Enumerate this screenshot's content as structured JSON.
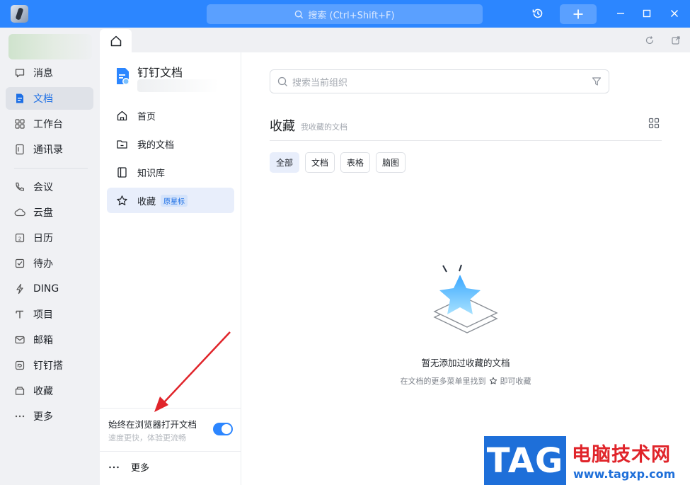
{
  "titlebar": {
    "search_placeholder": "搜索 (Ctrl+Shift+F)",
    "icons": [
      "app-logo",
      "history-icon",
      "plus-icon",
      "minimize-icon",
      "maximize-icon",
      "close-icon"
    ]
  },
  "rail": {
    "items": [
      {
        "label": "消息",
        "icon": "message-icon"
      },
      {
        "label": "文档",
        "icon": "document-icon",
        "active": true
      },
      {
        "label": "工作台",
        "icon": "workbench-icon"
      },
      {
        "label": "通讯录",
        "icon": "contacts-icon"
      },
      {
        "label": "会议",
        "icon": "meeting-icon"
      },
      {
        "label": "云盘",
        "icon": "cloud-icon"
      },
      {
        "label": "日历",
        "icon": "calendar-icon"
      },
      {
        "label": "待办",
        "icon": "todo-icon"
      },
      {
        "label": "DING",
        "icon": "ding-icon"
      },
      {
        "label": "项目",
        "icon": "project-icon"
      },
      {
        "label": "邮箱",
        "icon": "mail-icon"
      },
      {
        "label": "钉钉搭",
        "icon": "builder-icon"
      },
      {
        "label": "收藏",
        "icon": "favorites-icon"
      },
      {
        "label": "更多",
        "icon": "more-icon"
      }
    ]
  },
  "docnav": {
    "title": "钉钉文档",
    "items": [
      {
        "label": "首页",
        "icon": "home-icon"
      },
      {
        "label": "我的文档",
        "icon": "folder-icon"
      },
      {
        "label": "知识库",
        "icon": "book-icon"
      },
      {
        "label": "收藏",
        "icon": "star-icon",
        "badge": "原星标",
        "active": true
      }
    ],
    "browser_toggle_label": "始终在浏览器打开文档",
    "browser_toggle_sub": "速度更快，体验更流畅",
    "browser_toggle_on": true,
    "more_label": "更多"
  },
  "main": {
    "search_placeholder": "搜索当前组织",
    "section_title": "收藏",
    "section_sub": "我收藏的文档",
    "filters": [
      {
        "label": "全部",
        "active": true
      },
      {
        "label": "文档"
      },
      {
        "label": "表格"
      },
      {
        "label": "脑图"
      }
    ],
    "empty_title": "暂无添加过收藏的文档",
    "empty_sub_before": "在文档的更多菜单里找到",
    "empty_sub_after": "即可收藏"
  },
  "watermark": {
    "tag": "TAG",
    "cn": "电脑技术网",
    "url": "www.tagxp.com"
  },
  "colors": {
    "brand_blue": "#2c86ff",
    "annotation_red": "#e0242a"
  }
}
